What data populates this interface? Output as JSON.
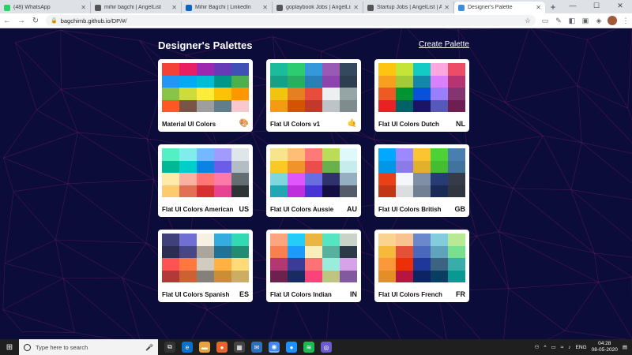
{
  "browser": {
    "tabs": [
      {
        "title": "(48) WhatsApp",
        "favicon": "whatsapp-icon",
        "color": "#25d366",
        "active": false
      },
      {
        "title": "mihir bagchi | AngelList",
        "favicon": "angellist-icon",
        "color": "#555555",
        "active": false
      },
      {
        "title": "Mihir Bagchi | LinkedIn",
        "favicon": "linkedin-icon",
        "color": "#0a66c2",
        "active": false
      },
      {
        "title": "goplaybook Jobs | AngelList",
        "favicon": "angellist-icon",
        "color": "#555555",
        "active": false
      },
      {
        "title": "Startup Jobs | AngelList | Ang",
        "favicon": "angellist-icon",
        "color": "#555555",
        "active": false
      },
      {
        "title": "Designer's Palette",
        "favicon": "react-icon",
        "color": "#3a8fd8",
        "active": true
      }
    ],
    "url": "bagchimb.github.io/DP/#/"
  },
  "page": {
    "title": "Designer's Palettes",
    "create_label": "Create Palette"
  },
  "palettes": [
    {
      "name": "Material UI Colors",
      "emoji": "🎨",
      "code": "",
      "colors": [
        "#f44336",
        "#e91e63",
        "#9c27b0",
        "#673ab7",
        "#3f51b5",
        "#2196f3",
        "#03a9f4",
        "#00bcd4",
        "#009688",
        "#4caf50",
        "#8bc34a",
        "#cddc39",
        "#ffeb3b",
        "#ffc107",
        "#ff9800",
        "#ff5722",
        "#795548",
        "#9e9e9e",
        "#607d8b",
        "#f8c8cc"
      ]
    },
    {
      "name": "Flat UI Colors v1",
      "emoji": "🤙",
      "code": "",
      "colors": [
        "#1abc9c",
        "#2ecc71",
        "#3498db",
        "#9b59b6",
        "#34495e",
        "#16a085",
        "#27ae60",
        "#2980b9",
        "#8e44ad",
        "#2c3e50",
        "#f1c40f",
        "#e67e22",
        "#e74c3c",
        "#ecf0f1",
        "#95a5a6",
        "#f39c12",
        "#d35400",
        "#c0392b",
        "#bdc3c7",
        "#7f8c8d"
      ]
    },
    {
      "name": "Flat UI Colors Dutch",
      "emoji": "",
      "code": "NL",
      "colors": [
        "#ffc312",
        "#c4e538",
        "#12cbc4",
        "#fda7df",
        "#ed4c67",
        "#f79f1f",
        "#a3cb38",
        "#1289a7",
        "#d980fa",
        "#b53471",
        "#ee5a24",
        "#009432",
        "#0652dd",
        "#9980fa",
        "#833471",
        "#ea2027",
        "#006266",
        "#1b1464",
        "#5758bb",
        "#6f1e51"
      ]
    },
    {
      "name": "Flat UI Colors American",
      "emoji": "",
      "code": "US",
      "colors": [
        "#55efc4",
        "#81ecec",
        "#74b9ff",
        "#a29bfe",
        "#dfe6e9",
        "#00b894",
        "#00cec9",
        "#0984e3",
        "#6c5ce7",
        "#b2bec3",
        "#ffeaa7",
        "#fab1a0",
        "#ff7675",
        "#fd79a8",
        "#636e72",
        "#fdcb6e",
        "#e17055",
        "#d63031",
        "#e84393",
        "#2d3436"
      ]
    },
    {
      "name": "Flat UI Colors Aussie",
      "emoji": "",
      "code": "AU",
      "colors": [
        "#f6e58d",
        "#ffbe76",
        "#ff7979",
        "#badc58",
        "#dff9fb",
        "#f9ca24",
        "#f0932b",
        "#eb4d4b",
        "#6ab04c",
        "#c7ecee",
        "#7ed6df",
        "#e056fd",
        "#686de0",
        "#30336b",
        "#95afc0",
        "#22a6b3",
        "#be2edd",
        "#4834d4",
        "#130f40",
        "#535c68"
      ]
    },
    {
      "name": "Flat UI Colors British",
      "emoji": "",
      "code": "GB",
      "colors": [
        "#00a8ff",
        "#9c88ff",
        "#fbc531",
        "#4cd137",
        "#487eb0",
        "#0097e6",
        "#8c7ae6",
        "#e1b12c",
        "#44bd32",
        "#40739e",
        "#e84118",
        "#f5f6fa",
        "#7f8fa6",
        "#273c75",
        "#353b48",
        "#c23616",
        "#dcdde1",
        "#718093",
        "#192a56",
        "#2f3640"
      ]
    },
    {
      "name": "Flat UI Colors Spanish",
      "emoji": "",
      "code": "ES",
      "colors": [
        "#40407a",
        "#706fd3",
        "#f7f1e3",
        "#34ace0",
        "#33d9b2",
        "#2c2c54",
        "#474787",
        "#aaa69d",
        "#227093",
        "#218c74",
        "#ff5252",
        "#ff793f",
        "#d1ccc0",
        "#ffb142",
        "#ffda79",
        "#b33939",
        "#cd6133",
        "#84817a",
        "#cc8e35",
        "#ccae62"
      ]
    },
    {
      "name": "Flat UI Colors Indian",
      "emoji": "",
      "code": "IN",
      "colors": [
        "#fea47f",
        "#25ccf7",
        "#eab543",
        "#55e6c1",
        "#cad3c8",
        "#f97f51",
        "#1b9cfc",
        "#f8efba",
        "#58b19f",
        "#2c3a47",
        "#b33771",
        "#3b3b98",
        "#fd7272",
        "#9aecdb",
        "#d6a2e8",
        "#6d214f",
        "#182c61",
        "#fc427b",
        "#bdc581",
        "#82589f"
      ]
    },
    {
      "name": "Flat UI Colors French",
      "emoji": "",
      "code": "FR",
      "colors": [
        "#fad390",
        "#f8c291",
        "#6a89cc",
        "#82ccdd",
        "#b8e994",
        "#f6b93b",
        "#e55039",
        "#4a69bd",
        "#60a3bc",
        "#78e08f",
        "#fa983a",
        "#eb2f06",
        "#1e3799",
        "#3c6382",
        "#38ada9",
        "#e58e26",
        "#b71540",
        "#0c2461",
        "#0a3d62",
        "#079992"
      ]
    }
  ],
  "taskbar": {
    "search_placeholder": "Type here to search",
    "lang": "ENG",
    "time": "04:28",
    "date": "08-05-2020"
  }
}
